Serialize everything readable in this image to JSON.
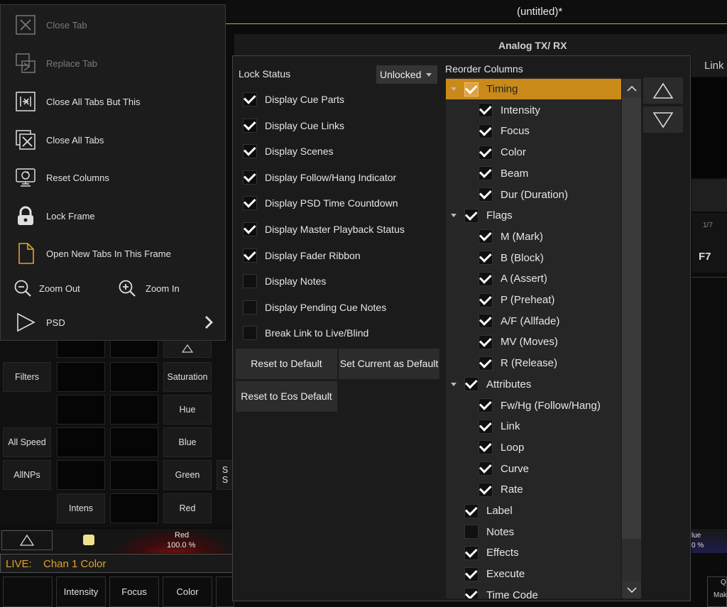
{
  "window": {
    "title": "(untitled)*",
    "frame_title": "Analog TX/ RX"
  },
  "background": {
    "link_label": "Link",
    "page_indicator": "1/7",
    "f7_label": "F7",
    "right_blue_name": "lue",
    "right_blue_value": "0 %",
    "right_bottom_q": "Q",
    "right_bottom_mak": "Mak"
  },
  "context_menu": {
    "items": [
      {
        "label": "Close Tab",
        "icon": "close-tab-icon",
        "disabled": true
      },
      {
        "label": "Replace Tab",
        "icon": "replace-tab-icon",
        "disabled": true
      },
      {
        "label": "Close All Tabs But This",
        "icon": "close-all-but-this-icon",
        "disabled": false
      },
      {
        "label": "Close All Tabs",
        "icon": "close-all-tabs-icon",
        "disabled": false
      },
      {
        "label": "Reset Columns",
        "icon": "reset-columns-icon",
        "disabled": false
      },
      {
        "label": "Lock Frame",
        "icon": "lock-icon",
        "disabled": false
      },
      {
        "label": "Open New Tabs In This Frame",
        "icon": "document-icon",
        "disabled": false
      }
    ],
    "zoom_out": "Zoom Out",
    "zoom_in": "Zoom In",
    "psd": "PSD"
  },
  "grid": {
    "filters": "Filters",
    "saturation": "Saturation",
    "hue": "Hue",
    "all_speed": "All Speed",
    "blue": "Blue",
    "allnps": "AllNPs",
    "green": "Green",
    "intens": "Intens",
    "red": "Red",
    "partial1": "S",
    "partial2": "S"
  },
  "fader_strip": {
    "red_name": "Red",
    "red_value": "100.0 %"
  },
  "command_line": {
    "mode": "LIVE:",
    "text": "Chan 1 Color"
  },
  "bottom_buttons": [
    "Intensity",
    "Focus",
    "Color"
  ],
  "dialog": {
    "lock_status_label": "Lock Status",
    "lock_status_value": "Unlocked",
    "options": [
      {
        "label": "Display Cue Parts",
        "checked": true
      },
      {
        "label": "Display Cue Links",
        "checked": true
      },
      {
        "label": "Display Scenes",
        "checked": true
      },
      {
        "label": "Display Follow/Hang Indicator",
        "checked": true
      },
      {
        "label": "Display PSD Time Countdown",
        "checked": true
      },
      {
        "label": "Display Master Playback Status",
        "checked": true
      },
      {
        "label": "Display Fader Ribbon",
        "checked": true
      },
      {
        "label": "Display Notes",
        "checked": false
      },
      {
        "label": "Display Pending Cue Notes",
        "checked": false
      },
      {
        "label": "Break Link to Live/Blind",
        "checked": false
      }
    ],
    "reset_default": "Reset to Default",
    "set_current_default": "Set Current as Default",
    "reset_eos_default": "Reset to Eos Default",
    "reorder_label": "Reorder Columns",
    "columns": [
      {
        "label": "Timing",
        "level": 0,
        "expand": true,
        "checked": true,
        "selected": true
      },
      {
        "label": "Intensity",
        "level": 1,
        "checked": true
      },
      {
        "label": "Focus",
        "level": 1,
        "checked": true
      },
      {
        "label": "Color",
        "level": 1,
        "checked": true
      },
      {
        "label": "Beam",
        "level": 1,
        "checked": true
      },
      {
        "label": "Dur (Duration)",
        "level": 1,
        "checked": true
      },
      {
        "label": "Flags",
        "level": 0,
        "expand": true,
        "checked": true
      },
      {
        "label": "M (Mark)",
        "level": 1,
        "checked": true
      },
      {
        "label": "B (Block)",
        "level": 1,
        "checked": true
      },
      {
        "label": "A (Assert)",
        "level": 1,
        "checked": true
      },
      {
        "label": "P (Preheat)",
        "level": 1,
        "checked": true
      },
      {
        "label": "A/F (Allfade)",
        "level": 1,
        "checked": true
      },
      {
        "label": "MV (Moves)",
        "level": 1,
        "checked": true
      },
      {
        "label": "R (Release)",
        "level": 1,
        "checked": true
      },
      {
        "label": "Attributes",
        "level": 0,
        "expand": true,
        "checked": true
      },
      {
        "label": "Fw/Hg (Follow/Hang)",
        "level": 1,
        "checked": true
      },
      {
        "label": "Link",
        "level": 1,
        "checked": true
      },
      {
        "label": "Loop",
        "level": 1,
        "checked": true
      },
      {
        "label": "Curve",
        "level": 1,
        "checked": true
      },
      {
        "label": "Rate",
        "level": 1,
        "checked": true
      },
      {
        "label": "Label",
        "level": 0,
        "checked": true
      },
      {
        "label": "Notes",
        "level": 0,
        "checked": false
      },
      {
        "label": "Effects",
        "level": 0,
        "checked": true
      },
      {
        "label": "Execute",
        "level": 0,
        "checked": true
      },
      {
        "label": "Time Code",
        "level": 0,
        "checked": true
      }
    ]
  },
  "colors": {
    "accent": "#d9a623",
    "selected_row": "#c98a1a",
    "live_text": "#e0a32a"
  }
}
